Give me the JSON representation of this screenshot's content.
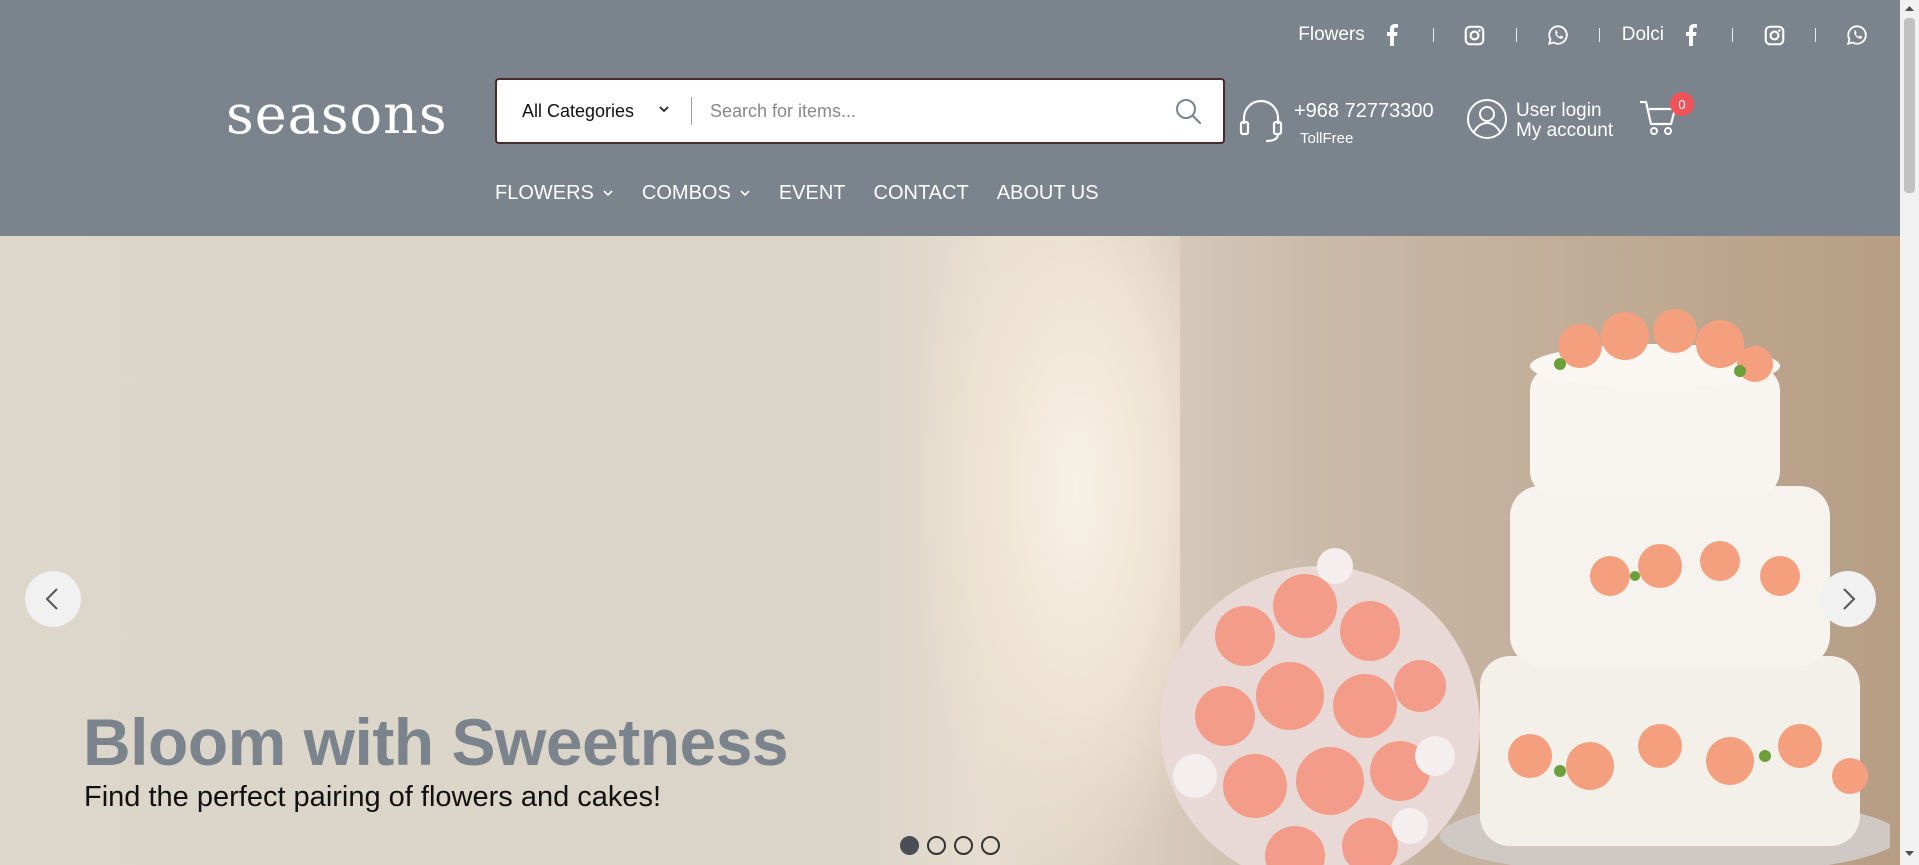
{
  "topbar": {
    "groups": [
      {
        "label": "Flowers",
        "icons": [
          "facebook-icon",
          "instagram-icon",
          "whatsapp-icon"
        ]
      },
      {
        "label": "Dolci",
        "icons": [
          "facebook-icon",
          "instagram-icon",
          "whatsapp-icon"
        ]
      }
    ]
  },
  "logo": "seasons",
  "search": {
    "category": "All Categories",
    "placeholder": "Search for items..."
  },
  "contact": {
    "phone": "+968 72773300",
    "sub": "TollFree"
  },
  "account": {
    "line1": "User login",
    "line2": "My account"
  },
  "cart": {
    "count": "0"
  },
  "nav": {
    "items": [
      {
        "label": "FLOWERS",
        "dropdown": true
      },
      {
        "label": "COMBOS",
        "dropdown": true
      },
      {
        "label": "EVENT",
        "dropdown": false
      },
      {
        "label": "CONTACT",
        "dropdown": false
      },
      {
        "label": "ABOUT US",
        "dropdown": false
      }
    ]
  },
  "hero": {
    "title": "Bloom with Sweetness",
    "subtitle": "Find the perfect pairing of flowers and cakes!",
    "slides_total": 4,
    "active_slide": 1
  },
  "colors": {
    "header_bg": "#7b838c",
    "badge": "#f0545a",
    "search_border": "#4a2a2a"
  }
}
